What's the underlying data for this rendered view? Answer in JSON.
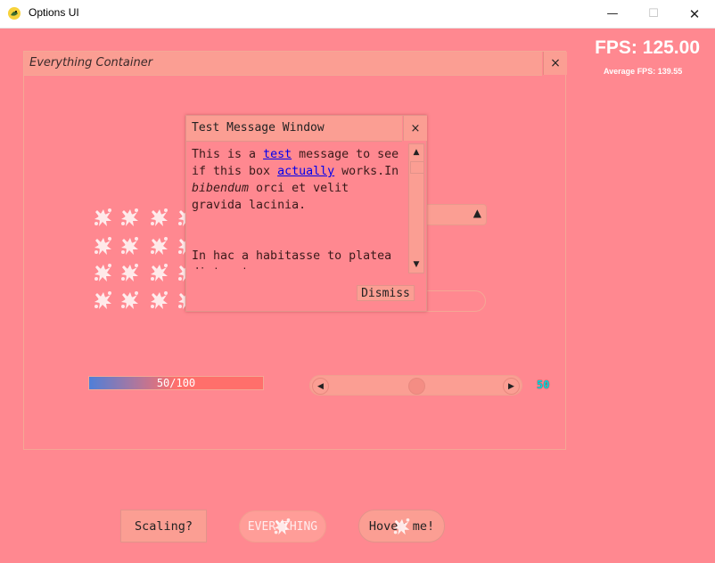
{
  "window": {
    "title": "Options UI",
    "minimize_icon": "—",
    "maximize_icon": "☐",
    "close_icon": "✕"
  },
  "stats": {
    "fps": "FPS: 125.00",
    "average_fps": "Average FPS: 139.55"
  },
  "container": {
    "title": "Everything Container",
    "close_icon": "×"
  },
  "dropdown": {
    "arrow": "▲"
  },
  "progress_bar": {
    "label": "50/100",
    "value": 50,
    "max": 100
  },
  "slider": {
    "left_arrow": "◀",
    "right_arrow": "▶",
    "value": 50,
    "min": 0,
    "max": 100,
    "value_label": "50"
  },
  "message_window": {
    "title": "Test Message Window",
    "close_icon": "×",
    "text_1": "This is a ",
    "link_1": "test",
    "text_2": " message to see if this box ",
    "link_2": "actually",
    "text_3": " works.In ",
    "italic_1": "bibendum",
    "text_4": " orci et velit gravida lacinia.",
    "text_5": " In hac a habitasse to platea dictumst.",
    "scroll_up": "▲",
    "scroll_down": "▼",
    "dismiss_label": "Dismiss"
  },
  "bottom_buttons": {
    "scaling": "Scaling?",
    "everything": "EVERYTHING",
    "hover": "Hover me!"
  },
  "colors": {
    "background": "#ff8890",
    "panel": "#fb9e93",
    "link": "#0000ee",
    "slider_value": "#0ad8dd"
  }
}
